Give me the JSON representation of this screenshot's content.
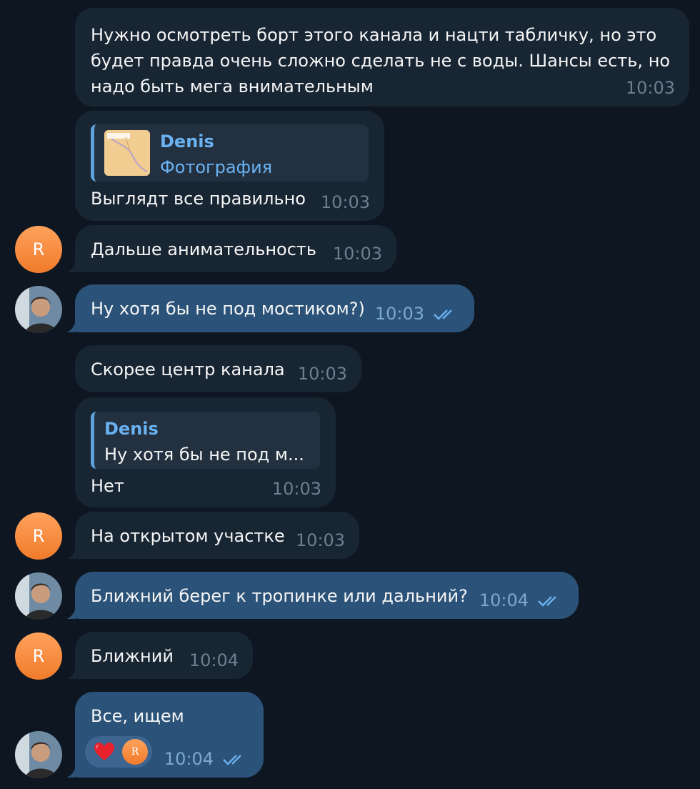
{
  "messages": {
    "m1": {
      "text": "Нужно осмотреть борт этого канала и нацти табличку, но это\nбудет правда очень сложно сделать не с воды. Шансы есть, но\nнадо быть мега внимательным",
      "time": "10:03"
    },
    "m2": {
      "reply_name": "Denis",
      "reply_sub": "Фотография",
      "text": "Выглядт все правильно",
      "time": "10:03"
    },
    "m3": {
      "text": "Дальше анимательность",
      "time": "10:03"
    },
    "m4": {
      "text": "Ну хотя бы не под мостиком?)",
      "time": "10:03"
    },
    "m5": {
      "text": "Скорее центр канала",
      "time": "10:03"
    },
    "m6": {
      "reply_name": "Denis",
      "reply_text": "Ну хотя бы не под м...",
      "text": "Нет",
      "time": "10:03"
    },
    "m7": {
      "text": "На открытом участке",
      "time": "10:03"
    },
    "m8": {
      "text": "Ближний берег к тропинке или дальний?",
      "time": "10:04"
    },
    "m9": {
      "text": "Ближний",
      "time": "10:04"
    },
    "m10": {
      "text": "Все, ищем",
      "time": "10:04",
      "reaction_emoji": "heart",
      "reaction_user_initial": "R"
    }
  },
  "avatars": {
    "contact_initial": "R"
  },
  "colors": {
    "background": "#0e1621",
    "incoming_bubble": "#182533",
    "outgoing_bubble": "#2b5278",
    "accent": "#6ab2f2",
    "avatar_orange": "#f88a3c"
  }
}
